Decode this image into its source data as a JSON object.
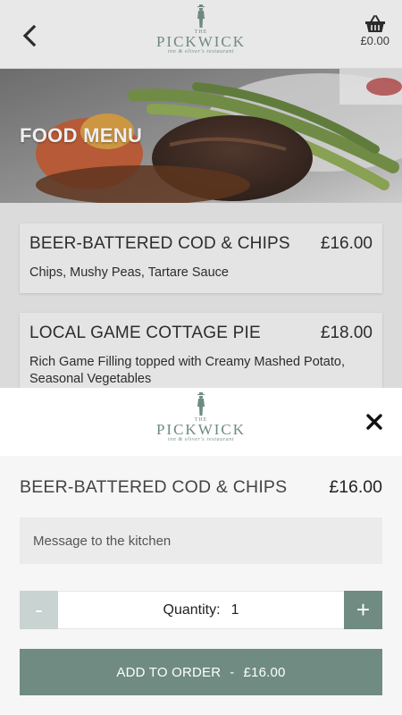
{
  "header": {
    "logo_small": "THE",
    "logo_name": "PICKWICK",
    "logo_tagline": "inn & oliver's restaurant",
    "basket_total": "£0.00"
  },
  "hero": {
    "title": "FOOD MENU"
  },
  "menu_items": [
    {
      "name": "BEER-BATTERED COD & CHIPS",
      "price": "£16.00",
      "description": "Chips, Mushy Peas, Tartare Sauce"
    },
    {
      "name": "LOCAL GAME COTTAGE PIE",
      "price": "£18.00",
      "description": "Rich Game Filling topped with Creamy Mashed Potato, Seasonal Vegetables"
    }
  ],
  "sheet": {
    "logo_small": "THE",
    "logo_name": "PICKWICK",
    "logo_tagline": "inn & oliver's restaurant",
    "item_name": "BEER-BATTERED COD & CHIPS",
    "item_price": "£16.00",
    "message_placeholder": "Message to the kitchen",
    "minus_label": "-",
    "plus_label": "+",
    "quantity_label": "Quantity:",
    "quantity_value": "1",
    "add_label": "ADD TO ORDER",
    "add_separator": "-",
    "add_price": "£16.00"
  },
  "icons": {
    "back": "chevron-left-icon",
    "basket": "basket-icon",
    "close": "close-icon",
    "logo": "pickwick-figure-icon"
  },
  "colors": {
    "accent": "#6f8b82",
    "minus_disabled": "#c9d3d1",
    "header_bg": "#f7f7f7",
    "sheet_bg": "#f6f6f6"
  }
}
